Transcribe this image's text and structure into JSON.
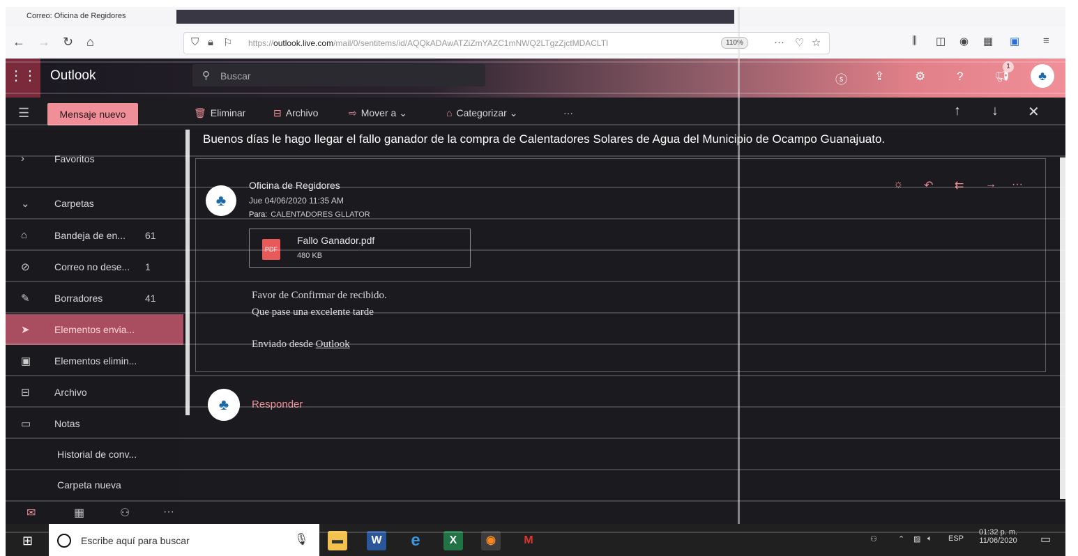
{
  "browser": {
    "tab_title": "Correo: Oficina de Regidores",
    "url_domain": "outlook.live.com",
    "url_prefix": "https://",
    "url_path": "/mail/0/sentitems/id/AQQkADAwATZiZmYAZC1mNWQ2LTgzZjctMDACLTI",
    "zoom": "110%"
  },
  "outlook": {
    "brand": "Outlook",
    "search_placeholder": "Buscar",
    "notification_count": "1",
    "avatar_text": "♣"
  },
  "commands": {
    "new_message": "Mensaje nuevo",
    "delete": "Eliminar",
    "archive": "Archivo",
    "move_to": "Mover a",
    "categorize": "Categorizar",
    "more": "···"
  },
  "nav": {
    "favorites": "Favoritos",
    "folders": "Carpetas",
    "items": [
      {
        "label": "Bandeja de en...",
        "count": "61",
        "icon": "inbox-icon"
      },
      {
        "label": "Correo no dese...",
        "count": "1",
        "icon": "junk-icon"
      },
      {
        "label": "Borradores",
        "count": "41",
        "icon": "drafts-icon"
      },
      {
        "label": "Elementos envia...",
        "count": "",
        "icon": "sent-icon"
      },
      {
        "label": "Elementos elimin...",
        "count": "",
        "icon": "trash-icon"
      },
      {
        "label": "Archivo",
        "count": "",
        "icon": "archive-icon"
      },
      {
        "label": "Notas",
        "count": "",
        "icon": "notes-icon"
      },
      {
        "label": "Historial de conv...",
        "count": "",
        "icon": ""
      },
      {
        "label": "Carpeta nueva",
        "count": "",
        "icon": ""
      }
    ]
  },
  "message": {
    "subject": "Buenos días le hago llegar el fallo ganador de la compra de Calentadores Solares de Agua del Municipio de Ocampo Guanajuato.",
    "sender": "Oficina de Regidores",
    "date": "Jue 04/06/2020 11:35 AM",
    "to_label": "Para:",
    "to": "CALENTADORES GLLATOR",
    "attachment_name": "Fallo Ganador.pdf",
    "attachment_size": "480 KB",
    "attachment_type": "PDF",
    "body_line1": "Favor de Confirmar de recibido.",
    "body_line2": "Que pase una excelente tarde",
    "signature_prefix": "Enviado desde",
    "signature_link": "Outlook",
    "reply": "Responder"
  },
  "taskbar": {
    "search_placeholder": "Escribe aquí para buscar",
    "language": "ESP",
    "time": "01:32 p. m.",
    "date": "11/06/2020"
  },
  "colors": {
    "accent": "#f08f98",
    "background": "#1b1a1f",
    "active_nav": "#a94e60"
  }
}
